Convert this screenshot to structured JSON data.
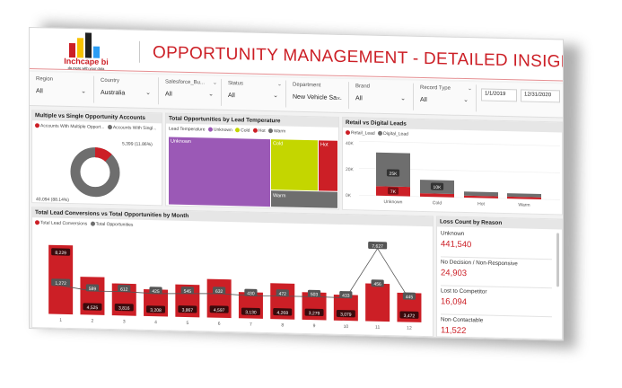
{
  "header": {
    "logo_text": "Inchcape bi",
    "logo_tagline": "do more with your data",
    "title": "OPPORTUNITY MANAGEMENT - DETAILED INSIGHTS"
  },
  "colors": {
    "accent": "#cc1f26",
    "grey": "#6e6e6e",
    "purple": "#9b59b6",
    "lime": "#c4d600",
    "logo_bars": [
      "#cc1f26",
      "#f7c200",
      "#1f1f1f",
      "#2a9df4"
    ]
  },
  "filters": [
    {
      "label": "Region",
      "value": "All"
    },
    {
      "label": "Country",
      "value": "Australia"
    },
    {
      "label": "Salesforce_Bu...",
      "value": "All"
    },
    {
      "label": "Status",
      "value": "All"
    },
    {
      "label": "Department",
      "value": "New Vehicle Sa..."
    },
    {
      "label": "Brand",
      "value": "All"
    },
    {
      "label": "Record Type",
      "value": "All"
    }
  ],
  "date_range": {
    "start": "1/1/2019",
    "end": "12/31/2020"
  },
  "donut": {
    "title": "Multiple vs Single Opportunity Accounts",
    "legend": [
      "Accounts With Multiple Opport...",
      "Accounts With Singl..."
    ],
    "label_small": "5,399 (11.86%)",
    "label_large": "40,094 (88.14%)"
  },
  "treemap": {
    "title": "Total Opportunities by Lead Temperature",
    "legend_title": "Lead Temperature",
    "legend": [
      "Unknown",
      "Cold",
      "Hot",
      "Warm"
    ],
    "tiles": [
      "Unknown",
      "Cold",
      "Hot",
      "Warm"
    ]
  },
  "retail": {
    "title": "Retail vs Digital Leads",
    "legend": [
      "Retail_Lead",
      "Digital_Lead"
    ],
    "ticks": [
      "40K",
      "20K",
      "0K"
    ],
    "labels": [
      "25K",
      "7K",
      "10K"
    ]
  },
  "monthly": {
    "title": "Total Lead Conversions vs Total Opportunities by Month",
    "legend": [
      "Total Lead Conversions",
      "Total Opportunities"
    ]
  },
  "loss": {
    "title": "Loss Count by Reason",
    "items": [
      {
        "name": "Unknown",
        "value": "441,540"
      },
      {
        "name": "No Decision / Non-Responsive",
        "value": "24,903"
      },
      {
        "name": "Lost to Competitor",
        "value": "16,094"
      },
      {
        "name": "Non-Contactable",
        "value": "11,522"
      }
    ]
  },
  "chart_data": [
    {
      "type": "pie",
      "title": "Multiple vs Single Opportunity Accounts",
      "series": [
        {
          "name": "Accounts With Multiple Opport...",
          "value": 5399,
          "percent": 11.86
        },
        {
          "name": "Accounts With Singl...",
          "value": 40094,
          "percent": 88.14
        }
      ]
    },
    {
      "type": "heatmap",
      "title": "Total Opportunities by Lead Temperature",
      "categories": [
        "Unknown",
        "Cold",
        "Hot",
        "Warm"
      ],
      "values": [
        48,
        27,
        10,
        8
      ]
    },
    {
      "type": "bar",
      "title": "Retail vs Digital Leads",
      "categories": [
        "Unknown",
        "Cold",
        "Hot",
        "Warm"
      ],
      "series": [
        {
          "name": "Retail_Lead",
          "values": [
            7000,
            2500,
            1500,
            1500
          ]
        },
        {
          "name": "Digital_Lead",
          "values": [
            25000,
            10000,
            3000,
            2500
          ]
        }
      ],
      "ylim": [
        0,
        40000
      ],
      "yticks": [
        "40K",
        "20K",
        "0K"
      ]
    },
    {
      "type": "bar",
      "title": "Total Lead Conversions vs Total Opportunities by Month",
      "categories": [
        "1",
        "2",
        "3",
        "4",
        "5",
        "6",
        "7",
        "8",
        "9",
        "10",
        "11",
        "12"
      ],
      "series": [
        {
          "name": "Total Lead Conversions",
          "values": [
            8229,
            4525,
            3816,
            3208,
            3867,
            4597,
            3130,
            4268,
            3279,
            3079,
            4500,
            3472
          ]
        },
        {
          "name": "Total Opportunities",
          "values": [
            1272,
            589,
            612,
            425,
            545,
            632,
            430,
            472,
            503,
            433,
            7627,
            445
          ]
        }
      ],
      "bar_labels": [
        "8,229",
        "4,525",
        "3,816",
        "3,208",
        "3,867",
        "4,597",
        "3,130",
        "4,268",
        "3,279",
        "3,079",
        "",
        "3,472"
      ],
      "line_labels": [
        "1,272",
        "589",
        "612",
        "425",
        "545",
        "632",
        "430",
        "472",
        "503",
        "433",
        "7,627",
        "445"
      ],
      "extra_label_month11": "456"
    }
  ]
}
